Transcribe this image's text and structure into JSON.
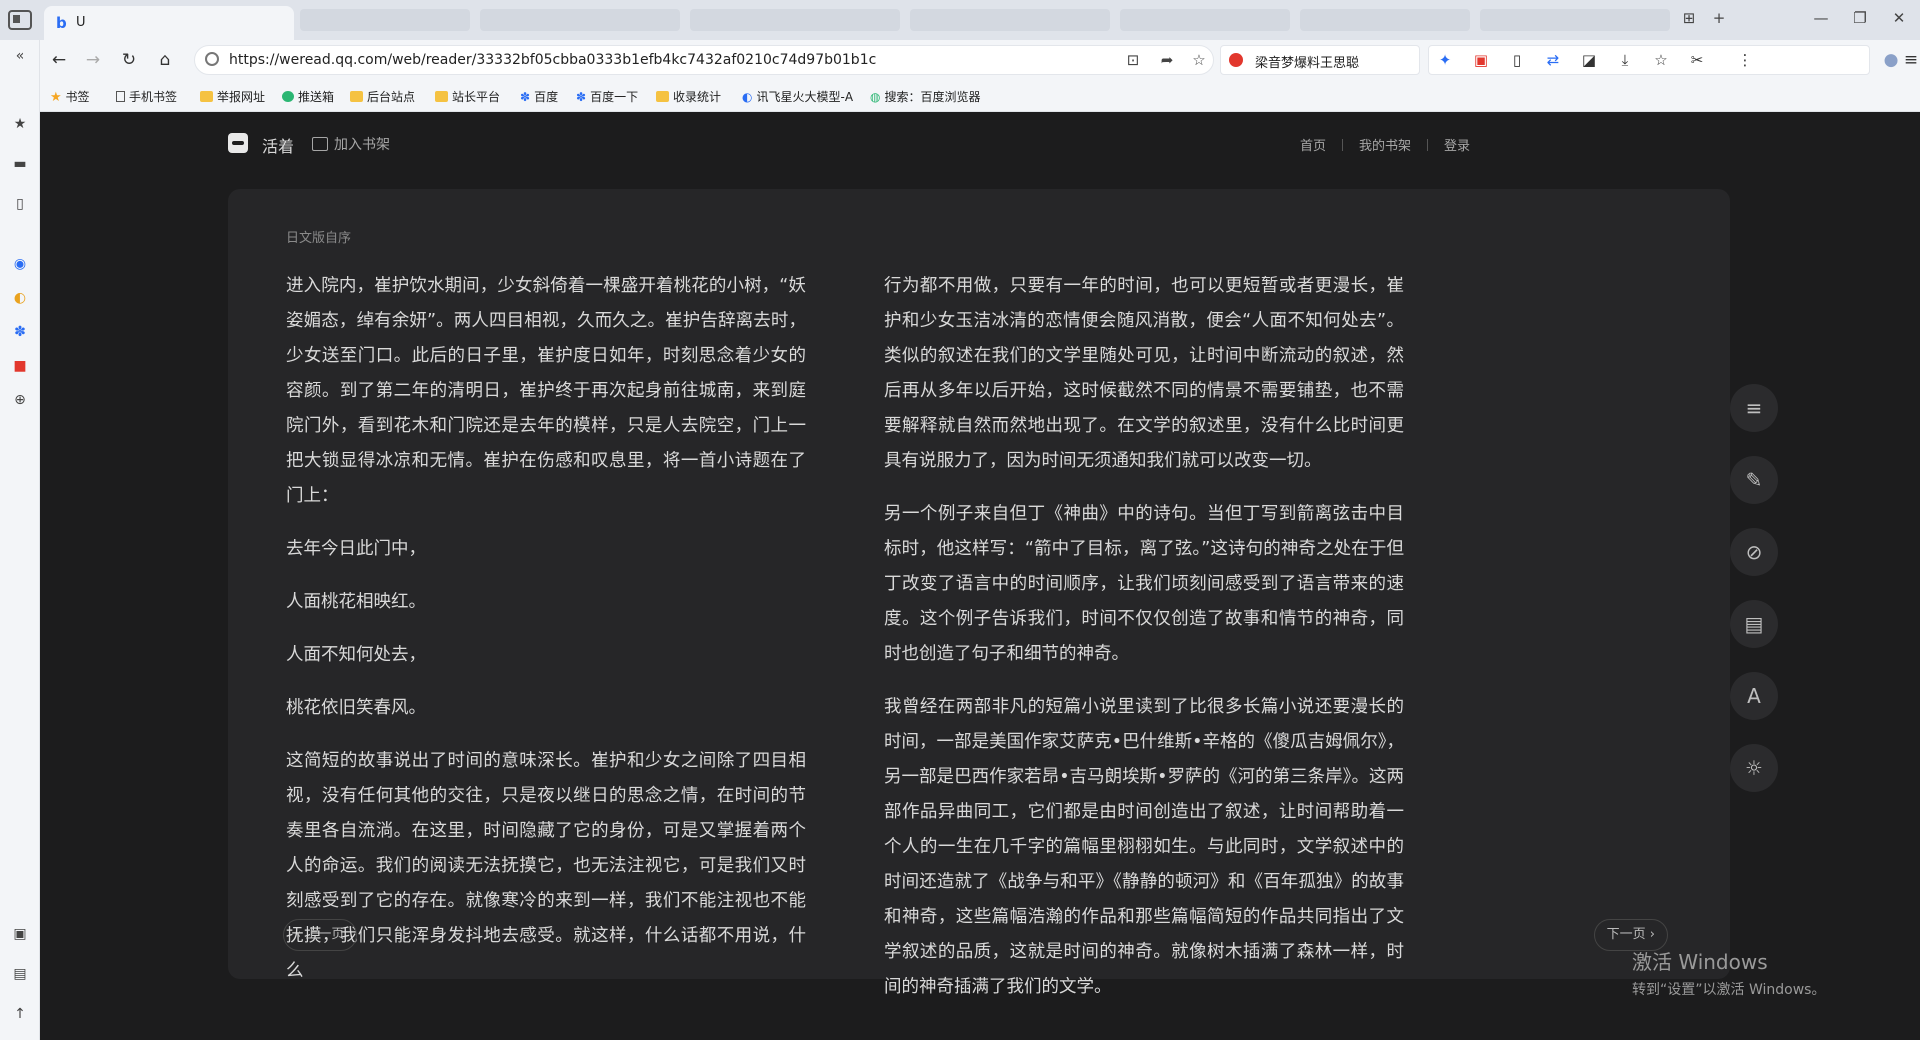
{
  "browser": {
    "tab_title": "U",
    "tab_favicon": "b",
    "url": "https://weread.qq.com/web/reader/33332bf05cbba0333b1efb4kc7432af0210c74d97b01b1c",
    "search_text": "梁音梦爆料王思聪",
    "controls": {
      "new_tab": "+",
      "minimize": "—",
      "restore": "❐",
      "close": "✕"
    }
  },
  "bookmarks": [
    {
      "label": "书签",
      "icon": "star-icon"
    },
    {
      "label": "手机书签",
      "icon": "phone-icon"
    },
    {
      "label": "举报网址",
      "icon": "folder-icon"
    },
    {
      "label": "推送箱",
      "icon": "push-icon"
    },
    {
      "label": "后台站点",
      "icon": "folder-icon"
    },
    {
      "label": "站长平台",
      "icon": "folder-icon"
    },
    {
      "label": "百度",
      "icon": "baidu-icon"
    },
    {
      "label": "百度一下",
      "icon": "baidu-icon"
    },
    {
      "label": "收录统计",
      "icon": "folder-icon"
    },
    {
      "label": "讯飞星火大模型-A",
      "icon": "spark-icon"
    },
    {
      "label": "搜索：百度浏览器",
      "icon": "search-icon"
    }
  ],
  "reader": {
    "book_title": "活着",
    "add_shelf": "加入书架",
    "links": [
      "首页",
      "我的书架",
      "登录"
    ],
    "chapter": "日文版自序",
    "left_paragraphs": [
      "进入院内，崔护饮水期间，少女斜倚着一棵盛开着桃花的小树，“妖姿媚态，绰有余妍”。两人四目相视，久而久之。崔护告辞离去时，少女送至门口。此后的日子里，崔护度日如年，时刻思念着少女的容颜。到了第二年的清明日，崔护终于再次起身前往城南，来到庭院门外，看到花木和门院还是去年的模样，只是人去院空，门上一把大锁显得冰凉和无情。崔护在伤感和叹息里，将一首小诗题在了门上：",
      "去年今日此门中，",
      "人面桃花相映红。",
      "人面不知何处去，",
      "桃花依旧笑春风。",
      "这简短的故事说出了时间的意味深长。崔护和少女之间除了四目相视，没有任何其他的交往，只是夜以继日的思念之情，在时间的节奏里各自流淌。在这里，时间隐藏了它的身份，可是又掌握着两个人的命运。我们的阅读无法抚摸它，也无法注视它，可是我们又时刻感受到了它的存在。就像寒冷的来到一样，我们不能注视也不能抚摸，我们只能浑身发抖地去感受。就这样，什么话都不用说，什么"
    ],
    "right_paragraphs": [
      "行为都不用做，只要有一年的时间，也可以更短暂或者更漫长，崔护和少女玉洁冰清的恋情便会随风消散，便会“人面不知何处去”。类似的叙述在我们的文学里随处可见，让时间中断流动的叙述，然后再从多年以后开始，这时候截然不同的情景不需要铺垫，也不需要解释就自然而然地出现了。在文学的叙述里，没有什么比时间更具有说服力了，因为时间无须通知我们就可以改变一切。",
      "另一个例子来自但丁《神曲》中的诗句。当但丁写到箭离弦击中目标时，他这样写：“箭中了目标，离了弦。”这诗句的神奇之处在于但丁改变了语言中的时间顺序，让我们顷刻间感受到了语言带来的速度。这个例子告诉我们，时间不仅仅创造了故事和情节的神奇，同时也创造了句子和细节的神奇。",
      "我曾经在两部非凡的短篇小说里读到了比很多长篇小说还要漫长的时间，一部是美国作家艾萨克•巴什维斯•辛格的《傻瓜吉姆佩尔》，另一部是巴西作家若昂•吉马朗埃斯•罗萨的《河的第三条岸》。这两部作品异曲同工，它们都是由时间创造出了叙述，让时间帮助着一个人的一生在几千字的篇幅里栩栩如生。与此同时，文学叙述中的时间还造就了《战争与和平》《静静的顿河》和《百年孤独》的故事和神奇，这些篇幅浩瀚的作品和那些篇幅简短的作品共同指出了文学叙述的品质，这就是时间的神奇。就像树木插满了森林一样，时间的神奇插满了我们的文学。"
    ],
    "prev": "上一页",
    "next": "下一页",
    "tools": [
      "catalog-icon",
      "note-pen-icon",
      "hide-icon",
      "review-icon",
      "font-icon",
      "theme-icon"
    ]
  },
  "watermark": {
    "line1": "激活 Windows",
    "line2": "转到“设置”以激活 Windows。"
  }
}
